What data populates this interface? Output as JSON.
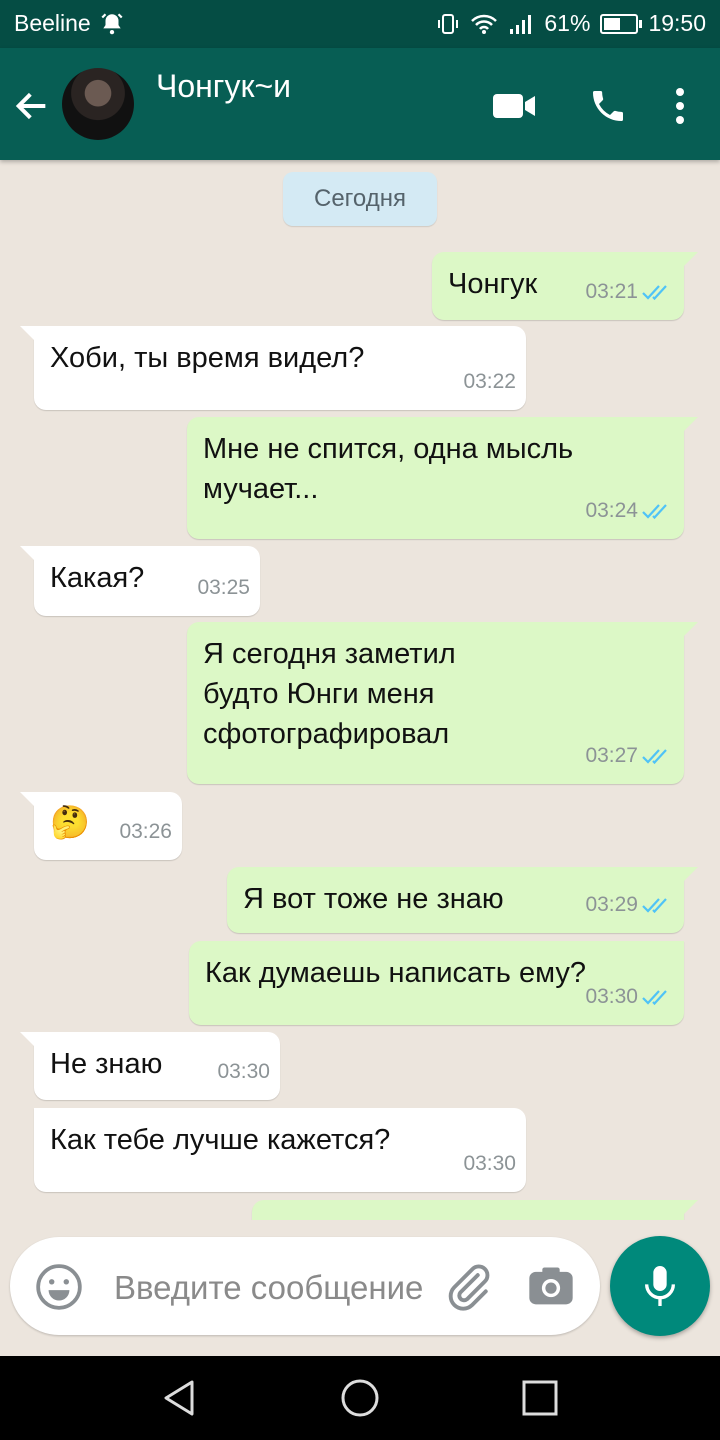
{
  "status_bar": {
    "carrier": "Beeline",
    "battery_percent": "61%",
    "battery_level": 0.61,
    "time": "19:50"
  },
  "header": {
    "contact_name": "Чонгук~и",
    "icons": [
      "back-arrow-icon",
      "avatar",
      "video-call-icon",
      "phone-icon",
      "more-vert-icon"
    ]
  },
  "chat": {
    "date_label": "Сегодня",
    "messages": [
      {
        "dir": "out",
        "text": "Чонгук",
        "time": "03:21",
        "read": true
      },
      {
        "dir": "in",
        "text": "Хоби, ты время видел?",
        "time": "03:22"
      },
      {
        "dir": "out",
        "text": "Мне не спится, одна мысль\nмучает...",
        "time": "03:24",
        "read": true
      },
      {
        "dir": "in",
        "text": "Какая?",
        "time": "03:25"
      },
      {
        "dir": "out",
        "text": "Я сегодня заметил\nбудто Юнги меня\nсфотографировал",
        "time": "03:27",
        "read": true
      },
      {
        "dir": "in",
        "text": "🤔",
        "time": "03:26"
      },
      {
        "dir": "out",
        "text": "Я вот тоже не знаю",
        "time": "03:29",
        "read": true
      },
      {
        "dir": "out",
        "text": "Как думаешь написать ему?",
        "time": "03:30",
        "read": true
      },
      {
        "dir": "in",
        "text": "Не знаю",
        "time": "03:30"
      },
      {
        "dir": "in",
        "text": "Как тебе лучше кажется?",
        "time": "03:30"
      },
      {
        "dir": "out",
        "text": "",
        "time": ""
      }
    ]
  },
  "composer": {
    "placeholder": "Введите сообщение"
  },
  "colors": {
    "header": "#075e54",
    "status_bar": "#054d44",
    "outgoing_bubble": "#dcf8c6",
    "incoming_bubble": "#ffffff",
    "read_ticks": "#4fc3f7",
    "accent": "#00897b"
  }
}
